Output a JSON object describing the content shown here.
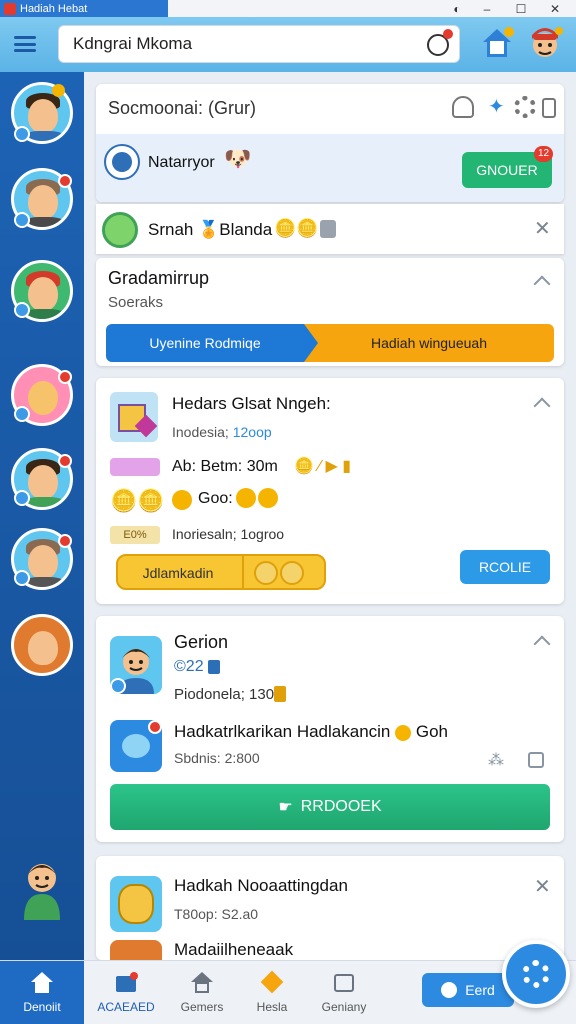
{
  "window": {
    "title": "Hadiah Hebat"
  },
  "header": {
    "search_value": "Kdngrai Mkoma"
  },
  "panel": {
    "title": "Socmoonai: (Grur)",
    "user_name": "Natarryor",
    "user_button": "GNOUER",
    "user_button_badge": "12"
  },
  "banner": {
    "text": "Srnah 🏅Blanda"
  },
  "group": {
    "title": "Gradamirrup",
    "subtitle": "Soeraks",
    "step_left": "Uyenine Rodmiqe",
    "step_right": "Hadiah wingueuah"
  },
  "offer": {
    "title": "Hedars Glsat Nngeh:",
    "meta_prefix": "Inodesia;",
    "meta_link": "12oop",
    "line1": "Ab: Betm: 30m",
    "line2": "Goo:",
    "chip": "E0%",
    "meta2": "Inoriesaln; 1ogroo",
    "claim_label": "Jdlamkadin",
    "button": "RCOLIE"
  },
  "profile": {
    "name": "Gerion",
    "id": "22",
    "meta": "Piodonela; 1300",
    "item_title": "Hadkatrlkarikan Hadlakancin",
    "item_suffix": "Goh",
    "item_meta": "Sbdnis: 2:800",
    "action_button": "RRDOOEK"
  },
  "last": {
    "title": "Hadkah Nooaattingdan",
    "meta": "T80op: S2.a0",
    "item_title": "Madaiilheneaak"
  },
  "nav": {
    "items": [
      {
        "label": "Denoiit"
      },
      {
        "label": "ACAEAED"
      },
      {
        "label": "Gemers"
      },
      {
        "label": "Hesla"
      },
      {
        "label": "Geniany"
      }
    ],
    "pill_label": "Eerd"
  },
  "colors": {
    "primary_blue": "#1f6bc3",
    "green": "#22b573",
    "orange": "#f6a50f",
    "red_badge": "#e53a2e"
  }
}
